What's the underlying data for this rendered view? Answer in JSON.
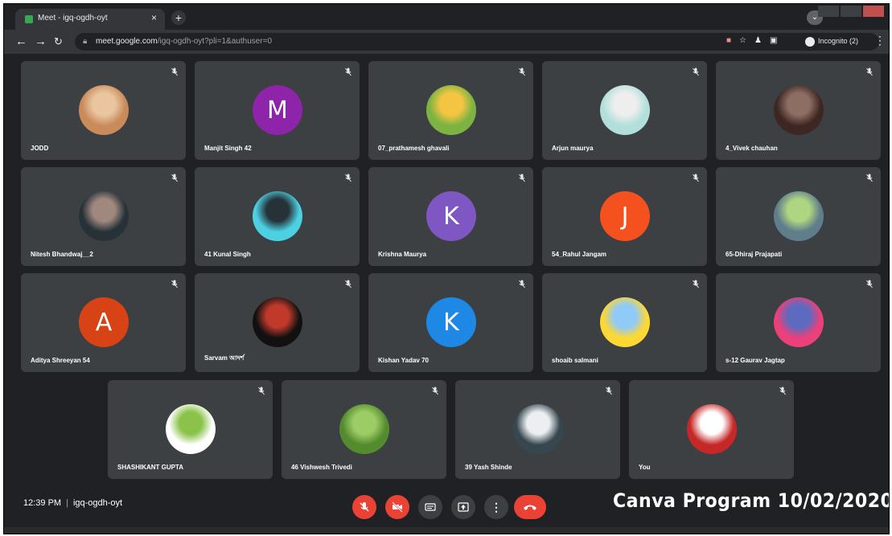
{
  "browser": {
    "tab_title": "Meet - igq-ogdh-oyt",
    "tab_close": "×",
    "new_tab": "+",
    "url_host": "meet.google.com",
    "url_path": "/igq-ogdh-oyt?pli=1&authuser=0",
    "incognito_label": "Incognito (2)"
  },
  "participants": [
    {
      "name": "JODD",
      "avatar": {
        "type": "photo",
        "colors": [
          "#c98b5a",
          "#e9c6a0"
        ]
      }
    },
    {
      "name": "Manjit Singh 42",
      "avatar": {
        "type": "letter",
        "letter": "M",
        "color": "#8e24aa"
      }
    },
    {
      "name": "07_prathamesh ghavali",
      "avatar": {
        "type": "photo",
        "colors": [
          "#7cb342",
          "#f4c542"
        ]
      }
    },
    {
      "name": "Arjun maurya",
      "avatar": {
        "type": "photo",
        "colors": [
          "#b2dfdb",
          "#eeeeee"
        ]
      }
    },
    {
      "name": "4_Vivek chauhan",
      "avatar": {
        "type": "photo",
        "colors": [
          "#3e2723",
          "#8d6e63"
        ]
      }
    },
    {
      "name": "Nitesh Bhandwaj__2",
      "avatar": {
        "type": "photo",
        "colors": [
          "#263238",
          "#a1887f"
        ]
      }
    },
    {
      "name": "41 Kunal Singh",
      "avatar": {
        "type": "photo",
        "colors": [
          "#4dd0e1",
          "#263238"
        ]
      }
    },
    {
      "name": "Krishna Maurya",
      "avatar": {
        "type": "letter",
        "letter": "K",
        "color": "#7e57c2"
      }
    },
    {
      "name": "54_Rahul Jangam",
      "avatar": {
        "type": "letter",
        "letter": "J",
        "color": "#f4511e"
      }
    },
    {
      "name": "65-Dhiraj Prajapati",
      "avatar": {
        "type": "photo",
        "colors": [
          "#607d8b",
          "#aed581"
        ]
      }
    },
    {
      "name": "Aditya Shreeyan 54",
      "avatar": {
        "type": "letter",
        "letter": "A",
        "color": "#d84315"
      }
    },
    {
      "name": "Sarvam আদর্শ",
      "avatar": {
        "type": "photo",
        "colors": [
          "#111111",
          "#c0392b"
        ]
      }
    },
    {
      "name": "Kishan Yadav 70",
      "avatar": {
        "type": "letter",
        "letter": "K",
        "color": "#1e88e5"
      }
    },
    {
      "name": "shoaib salmani",
      "avatar": {
        "type": "photo",
        "colors": [
          "#fdd835",
          "#90caf9"
        ]
      }
    },
    {
      "name": "s-12 Gaurav Jagtap",
      "avatar": {
        "type": "photo",
        "colors": [
          "#ec407a",
          "#5c6bc0"
        ]
      }
    },
    {
      "name": "SHASHIKANT GUPTA",
      "avatar": {
        "type": "photo",
        "colors": [
          "#ffffff",
          "#8bc34a"
        ]
      }
    },
    {
      "name": "46 Vishwesh Trivedi",
      "avatar": {
        "type": "photo",
        "colors": [
          "#558b2f",
          "#9ccc65"
        ]
      }
    },
    {
      "name": "39 Yash Shinde",
      "avatar": {
        "type": "photo",
        "colors": [
          "#37474f",
          "#eceff1"
        ]
      }
    },
    {
      "name": "You",
      "avatar": {
        "type": "photo",
        "colors": [
          "#c62828",
          "#ffffff"
        ]
      }
    }
  ],
  "meeting": {
    "time": "12:39 PM",
    "separator": "|",
    "code": "igq-ogdh-oyt"
  },
  "controls": [
    "mic-off",
    "camera-off",
    "captions",
    "present",
    "more-options",
    "leave-call"
  ],
  "caption_overlay": "Canva Program 10/02/2020",
  "colors": {
    "background": "#202124",
    "tile": "#3c4043",
    "danger": "#ea4335"
  }
}
